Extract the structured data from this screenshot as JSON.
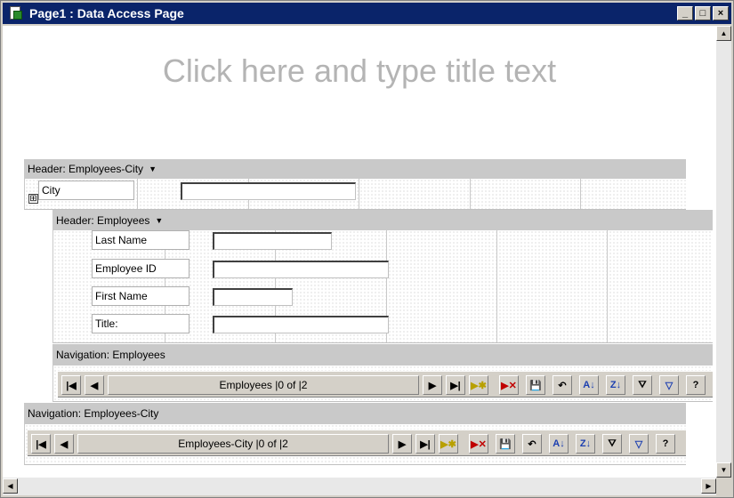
{
  "window": {
    "title": "Page1 : Data Access Page",
    "minimize": "_",
    "maximize": "□",
    "close": "×"
  },
  "page": {
    "title_placeholder": "Click here and type title text"
  },
  "group_city": {
    "header_label": "Header: Employees-City",
    "field_label": "City",
    "expand_glyph": "⊞"
  },
  "group_employees": {
    "header_label": "Header: Employees",
    "fields": [
      {
        "label": "Last Name"
      },
      {
        "label": "Employee ID"
      },
      {
        "label": "First Name"
      },
      {
        "label": "Title:"
      }
    ]
  },
  "nav_employees": {
    "section_label": "Navigation: Employees",
    "record_text": "Employees |0 of |2"
  },
  "nav_city": {
    "section_label": "Navigation: Employees-City",
    "record_text": "Employees-City |0 of |2"
  },
  "nav_buttons": {
    "first": "|◀",
    "prev": "◀",
    "next": "▶",
    "last": "▶|",
    "new": "▶✱",
    "delete": "▶✕",
    "save": "💾",
    "undo": "↶",
    "sort_asc": "A↓",
    "sort_desc": "Z↓",
    "filter_by_selection": "⛛",
    "toggle_filter": "▽",
    "help": "?"
  },
  "scrollbars": {
    "up": "▲",
    "down": "▼",
    "left": "◀",
    "right": "▶"
  }
}
